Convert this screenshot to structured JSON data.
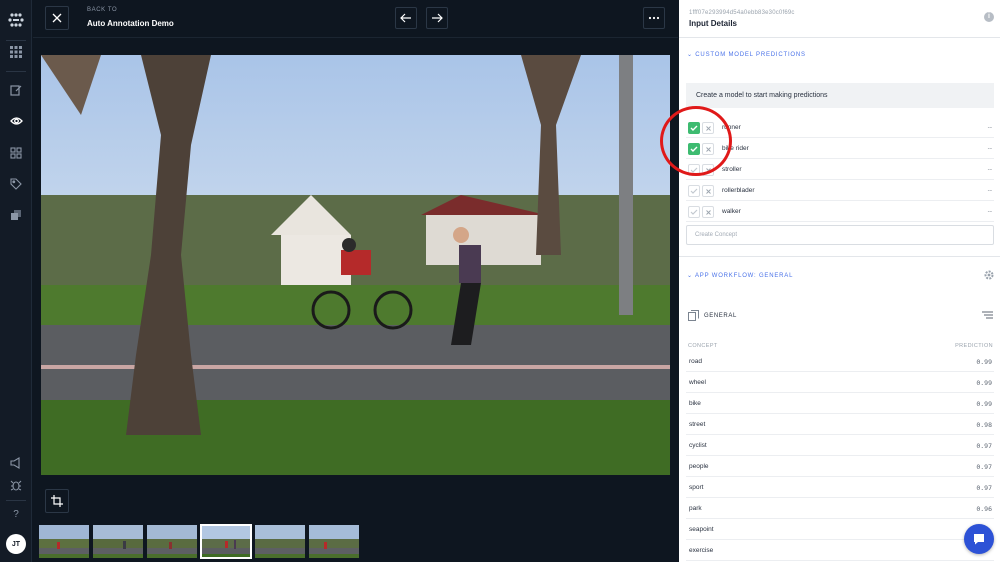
{
  "header": {
    "back_to": "BACK TO",
    "project_name": "Auto Annotation Demo"
  },
  "rail": {
    "help": "?",
    "avatar_initials": "JT"
  },
  "panel": {
    "input_id": "1fff07e293994d54a0ebb83e30c0f69c",
    "title": "Input Details",
    "custom_section": "CUSTOM MODEL PREDICTIONS",
    "notice": "Create a model to start making predictions",
    "concepts": [
      {
        "name": "runner",
        "checked": true,
        "value": "--"
      },
      {
        "name": "bike rider",
        "checked": true,
        "value": "--"
      },
      {
        "name": "stroller",
        "checked": false,
        "value": "--"
      },
      {
        "name": "rollerblader",
        "checked": false,
        "value": "--"
      },
      {
        "name": "walker",
        "checked": false,
        "value": "--"
      }
    ],
    "create_concept_placeholder": "Create Concept",
    "workflow_section": "APP WORKFLOW: GENERAL",
    "model_label": "GENERAL",
    "col_concept": "CONCEPT",
    "col_prediction": "PREDICTION",
    "predictions": [
      {
        "name": "road",
        "value": "0.99"
      },
      {
        "name": "wheel",
        "value": "0.99"
      },
      {
        "name": "bike",
        "value": "0.99"
      },
      {
        "name": "street",
        "value": "0.98"
      },
      {
        "name": "cyclist",
        "value": "0.97"
      },
      {
        "name": "people",
        "value": "0.97"
      },
      {
        "name": "sport",
        "value": "0.97"
      },
      {
        "name": "park",
        "value": "0.96"
      },
      {
        "name": "seapoint",
        "value": ""
      },
      {
        "name": "exercise",
        "value": ""
      }
    ]
  },
  "colors": {
    "accent": "#4a72e8",
    "check_green": "#3dbb70",
    "annotation_red": "#e01919",
    "chat_blue": "#2d52d6",
    "viewer_bg": "#0e1620"
  }
}
